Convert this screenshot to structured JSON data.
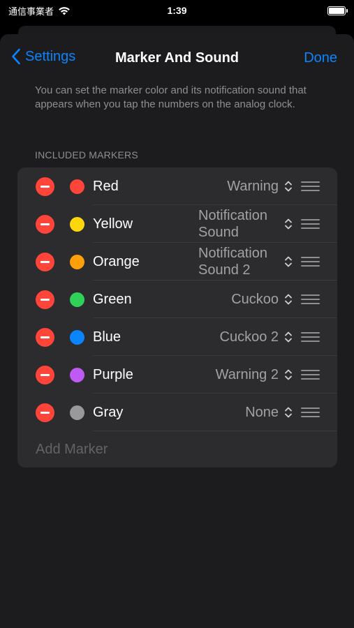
{
  "status_bar": {
    "carrier": "通信事業者",
    "time": "1:39"
  },
  "nav": {
    "back_label": "Settings",
    "title": "Marker And Sound",
    "done_label": "Done"
  },
  "description": "You can set the marker color and its notification sound that appears when you tap the numbers on the analog clock.",
  "section_header": "INCLUDED MARKERS",
  "markers": [
    {
      "name": "Red",
      "color": "#ff453a",
      "sound": "Warning"
    },
    {
      "name": "Yellow",
      "color": "#ffd60a",
      "sound": "Notification Sound"
    },
    {
      "name": "Orange",
      "color": "#ff9f0a",
      "sound": "Notification Sound 2"
    },
    {
      "name": "Green",
      "color": "#30d158",
      "sound": "Cuckoo"
    },
    {
      "name": "Blue",
      "color": "#0a84ff",
      "sound": "Cuckoo 2"
    },
    {
      "name": "Purple",
      "color": "#bf5af2",
      "sound": "Warning 2"
    },
    {
      "name": "Gray",
      "color": "#98989d",
      "sound": "None"
    }
  ],
  "add_marker_label": "Add Marker",
  "colors": {
    "accent": "#0a84ff",
    "delete": "#ff453a",
    "background": "#1c1c1e",
    "cell": "#2c2c2e"
  }
}
